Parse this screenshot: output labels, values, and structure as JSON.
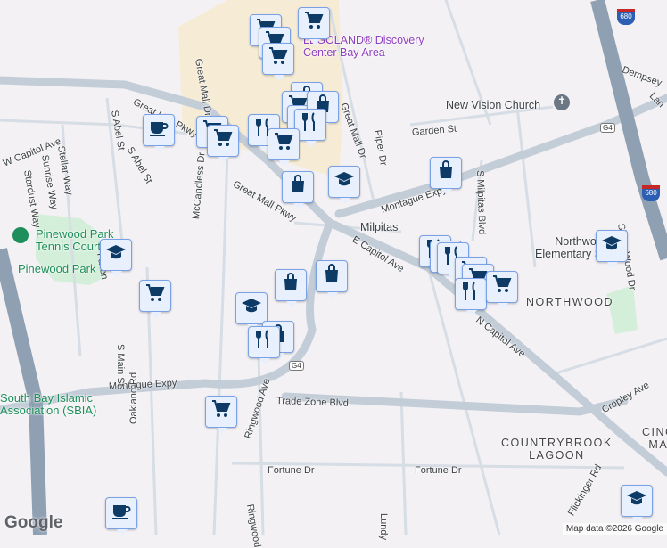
{
  "map": {
    "places": {
      "legoland": "LEGOLAND® Discovery",
      "legoland2": "Center Bay Area",
      "church": "New Vision Church",
      "milpitas": "Milpitas",
      "northwood_school": "Northwood",
      "northwood_school2": "Elementary School",
      "tennis": "Pinewood Park",
      "tennis2": "Tennis Court",
      "park": "Pinewood Park",
      "sbia": "South Bay Islamic",
      "sbia2": "Association (SBIA)"
    },
    "neighborhoods": {
      "northwood": "NORTHWOOD",
      "countrybrook": "COUNTRYBROOK",
      "countrybrook2": "LAGOON",
      "cinc": "CINC",
      "cinc2": "MA"
    },
    "streets": {
      "great_mall_pkwy_1": "Great Mall Pkwy",
      "great_mall_pkwy_2": "Great Mall Pkwy",
      "great_mall_dr_1": "Great Mall Dr",
      "great_mall_dr_2": "Great Mall Dr",
      "piper": "Piper Dr",
      "garden": "Garden St",
      "dempsey": "Dempsey",
      "lan": "Lan",
      "montague_1": "Montague Expy",
      "montague_2": "Montague Expy",
      "s_milpitas": "S Milpitas Blvd",
      "e_capitol": "E Capitol Ave",
      "n_capitol": "N Capitol Ave",
      "sierra_wood": "Sierra Wood Dr",
      "mccandless": "McCandless Dr",
      "s_abel_1": "S Abel St",
      "s_abel_2": "S Abel St",
      "w_capitol": "W Capitol Ave",
      "stardust": "Stardust Way",
      "sunrise": "Sunrise Way",
      "stellar": "Stellar Way",
      "fallen": "Fallen",
      "s_main": "S Main St",
      "oakland": "Oakland Rd",
      "trade_zone": "Trade Zone Blvd",
      "ringwood_1": "Ringwood Ave",
      "ringwood_2": "Ringwood",
      "fortune_1": "Fortune Dr",
      "fortune_2": "Fortune Dr",
      "lundy": "Lundy",
      "cropley": "Cropley Ave",
      "flickinger": "Flickinger Rd"
    },
    "shields": {
      "g4": "G4",
      "i680": "680"
    },
    "markers": [
      "cart",
      "cart",
      "cart",
      "cart",
      "bag",
      "cart",
      "restaurant",
      "bag",
      "restaurant",
      "restaurant",
      "cart",
      "cart",
      "cart",
      "coffee",
      "bag",
      "school",
      "bag",
      "school",
      "cart",
      "restaurant",
      "restaurant",
      "restaurant",
      "cart",
      "cart",
      "restaurant",
      "cart",
      "bag",
      "bag",
      "school",
      "bag",
      "restaurant",
      "cart",
      "coffee",
      "school",
      "school"
    ],
    "attribution": "Map data ©2026 Google",
    "logo": "Google"
  }
}
